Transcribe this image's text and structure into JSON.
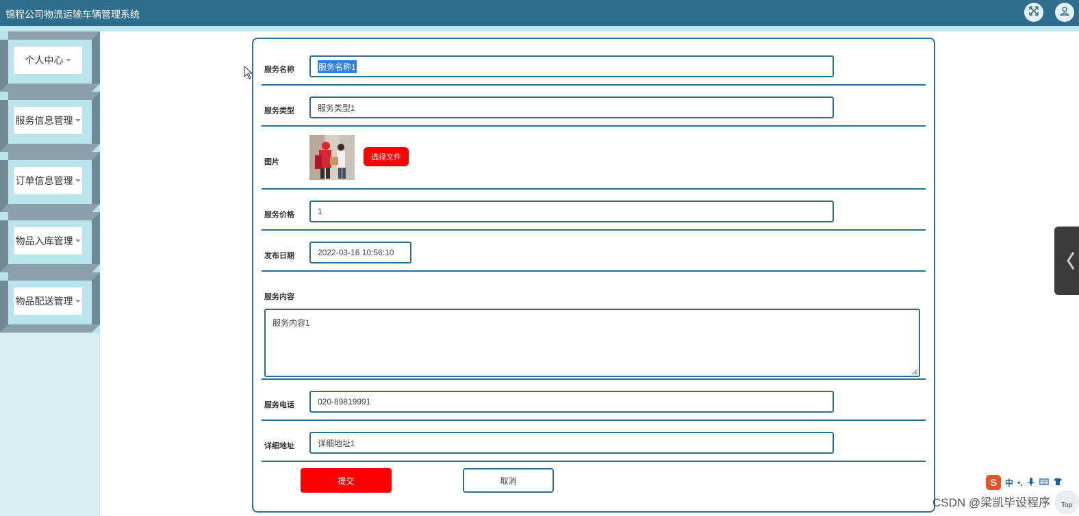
{
  "header": {
    "title": "锦程公司物流运输车辆管理系统"
  },
  "sidebar": {
    "items": [
      {
        "label": "个人中心"
      },
      {
        "label": "服务信息管理"
      },
      {
        "label": "订单信息管理"
      },
      {
        "label": "物品入库管理"
      },
      {
        "label": "物品配送管理"
      }
    ]
  },
  "form": {
    "fields": {
      "service_name": {
        "label": "服务名称",
        "value": "服务名称1"
      },
      "service_type": {
        "label": "服务类型",
        "value": "服务类型1"
      },
      "image": {
        "label": "图片",
        "button": "选择文件"
      },
      "price": {
        "label": "服务价格",
        "value": "1"
      },
      "publish_date": {
        "label": "发布日期",
        "value": "2022-03-16 10:56:10"
      },
      "content": {
        "label": "服务内容",
        "value": "服务内容1"
      },
      "phone": {
        "label": "服务电话",
        "value": "020-89819991"
      },
      "address": {
        "label": "详细地址",
        "value": "详细地址1"
      }
    },
    "submit_label": "提交",
    "cancel_label": "取消"
  },
  "overlay": {
    "ime_lang": "中",
    "ime_punct": "•,",
    "watermark": "CSDN @梁凯毕设程序",
    "top_label": "Top"
  },
  "colors": {
    "header_bg": "#2e6e8c",
    "accent_red": "#ff0000",
    "sidebar_bg": "#d6eef0"
  }
}
